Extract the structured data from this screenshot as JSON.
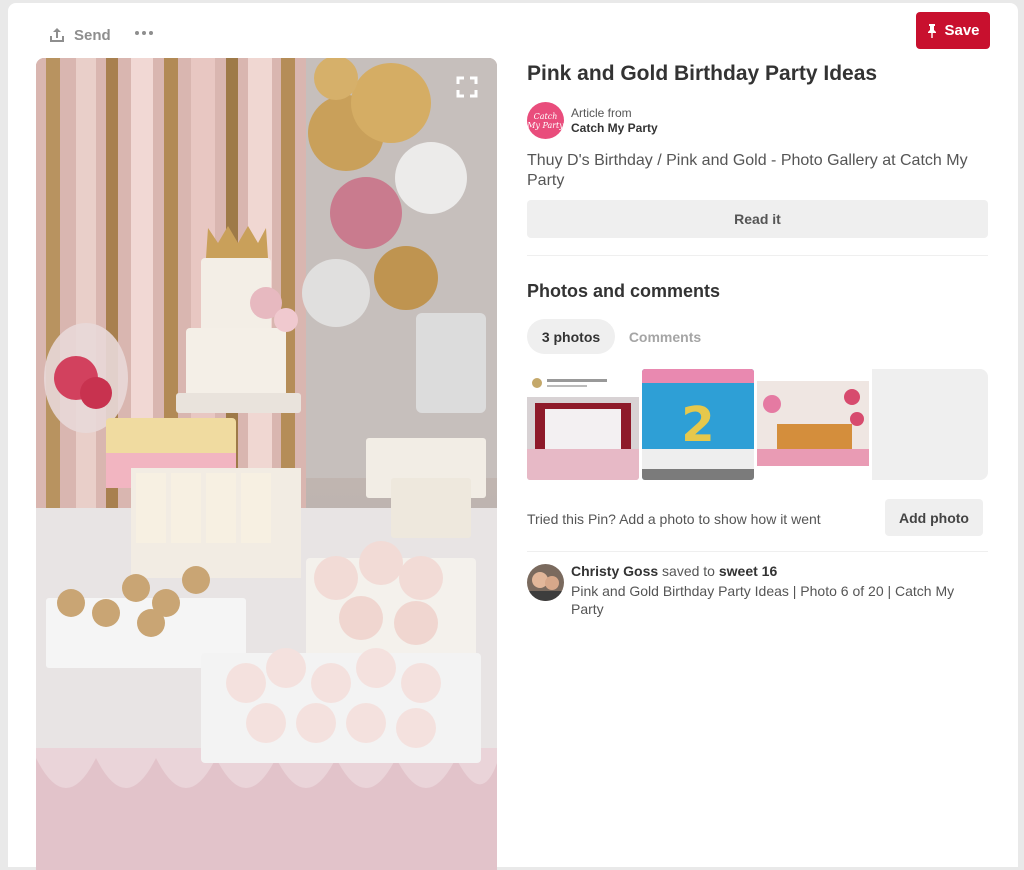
{
  "toolbar": {
    "send_label": "Send",
    "send_icon": "share-upload-icon",
    "more_icon": "more-dots-icon",
    "save_label": "Save",
    "save_icon": "pin-icon",
    "accent_color": "#c8102e"
  },
  "pin": {
    "image_desc_icon": "expand-icon",
    "title": "Pink and Gold Birthday Party Ideas",
    "source": {
      "logo_text": "Catch My Party",
      "from_label": "Article from",
      "name": "Catch My Party",
      "logo_color": "#e94d7c"
    },
    "description": "Thuy D's Birthday / Pink and Gold - Photo Gallery at Catch My Party",
    "read_button": "Read it"
  },
  "photos_section": {
    "title": "Photos and comments",
    "tabs": [
      {
        "label": "3 photos",
        "active": true
      },
      {
        "label": "Comments",
        "active": false
      }
    ],
    "tried_text": "Tried this Pin? Add a photo to show how it went",
    "add_photo_button": "Add photo"
  },
  "activity": {
    "user": "Christy Goss",
    "action": "saved to",
    "board": "sweet 16",
    "description": "Pink and Gold Birthday Party Ideas | Photo 6 of 20 | Catch My Party"
  }
}
